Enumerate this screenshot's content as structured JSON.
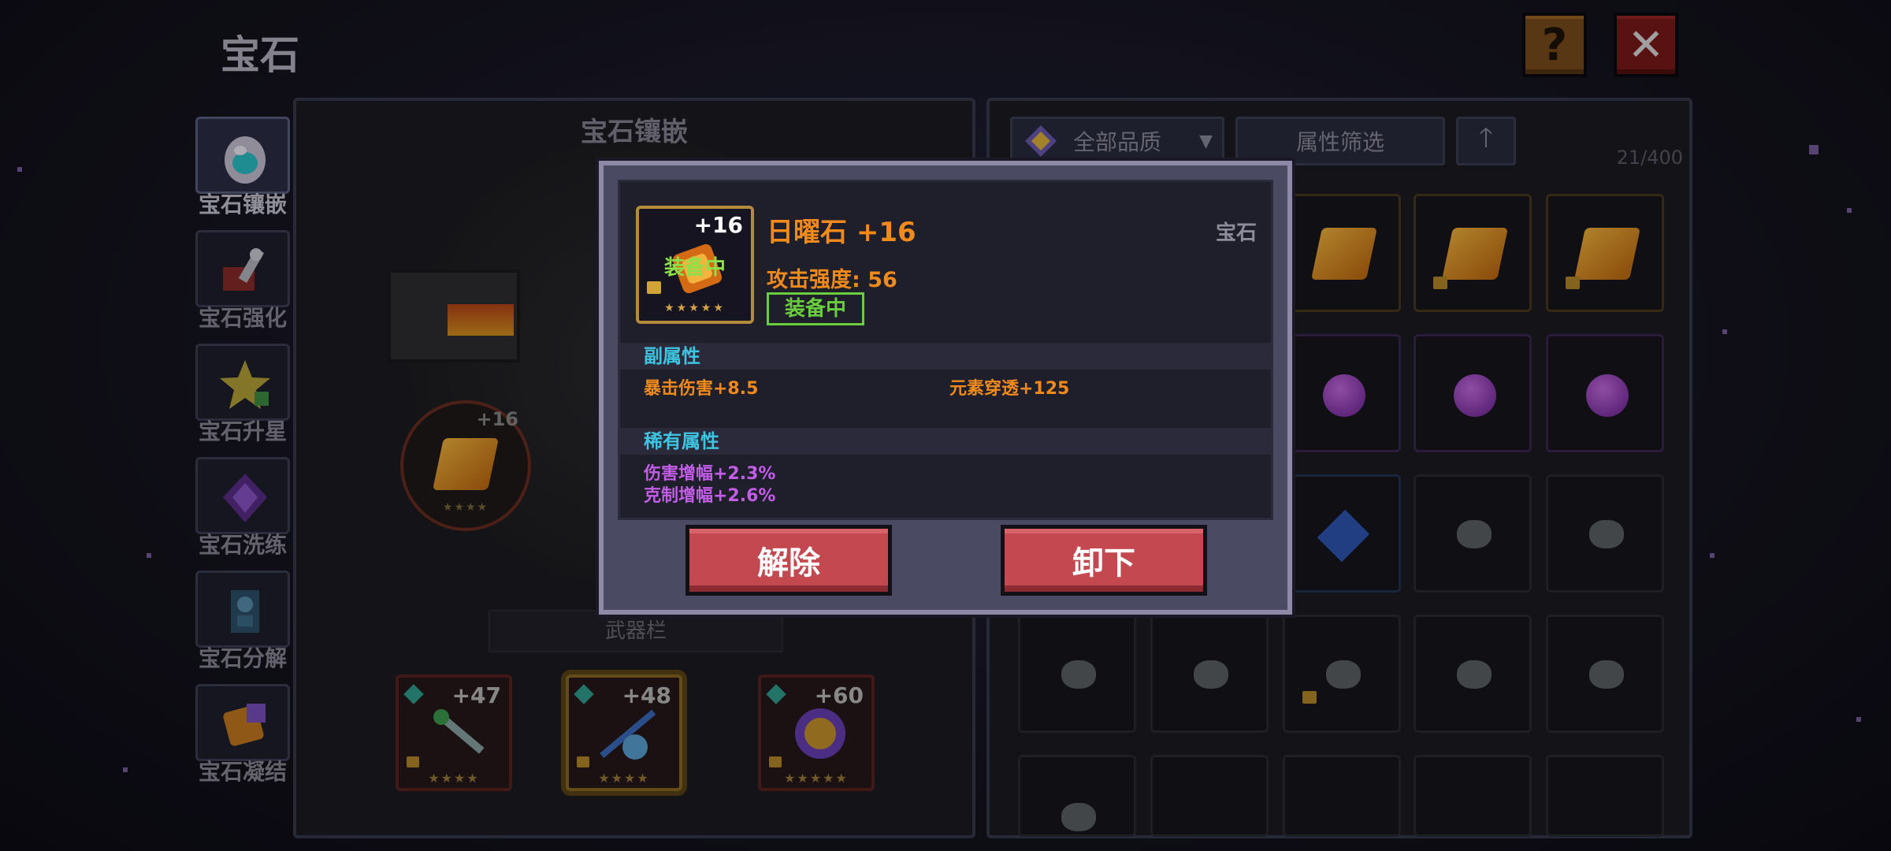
{
  "page": {
    "title": "宝石"
  },
  "side_tabs": [
    {
      "label": "宝石镶嵌",
      "icon": "egg-gem-icon",
      "active": true
    },
    {
      "label": "宝石强化",
      "icon": "hammer-icon",
      "active": false
    },
    {
      "label": "宝石升星",
      "icon": "star-icon",
      "active": false
    },
    {
      "label": "宝石洗练",
      "icon": "purple-crystal-icon",
      "active": false
    },
    {
      "label": "宝石分解",
      "icon": "skull-crystal-icon",
      "active": false
    },
    {
      "label": "宝石凝结",
      "icon": "fuse-scroll-icon",
      "active": false
    }
  ],
  "inlay_panel": {
    "title": "宝石镶嵌",
    "socket_level": "+16",
    "weapon_bar_label": "武器栏",
    "weapons": [
      {
        "level": "+47",
        "icon": "green-staff-icon",
        "selected": false
      },
      {
        "level": "+48",
        "icon": "blue-sword-icon",
        "selected": true
      },
      {
        "level": "+60",
        "icon": "purple-orb-icon",
        "selected": false
      }
    ]
  },
  "inventory": {
    "quality_filter": "全部品质",
    "attr_filter": "属性筛选",
    "count": "21/400"
  },
  "modal": {
    "item_level": "+16",
    "equip_badge": "装备中",
    "name": "日曜石 +16",
    "type": "宝石",
    "attack": "攻击强度: 56",
    "status": "装备中",
    "sub_title": "副属性",
    "sub_attrs": [
      "暴击伤害+8.5",
      "元素穿透+125"
    ],
    "rare_title": "稀有属性",
    "rare_attrs": [
      "伤害增幅+2.3%",
      "克制增幅+2.6%"
    ],
    "btn_remove": "解除",
    "btn_unequip": "卸下"
  },
  "colors": {
    "accent_orange": "#f08a1c",
    "equipped_green": "#6acd3d",
    "section_cyan": "#3ec4e0",
    "rare_purple": "#c35de8",
    "button_red": "#c4484f"
  }
}
